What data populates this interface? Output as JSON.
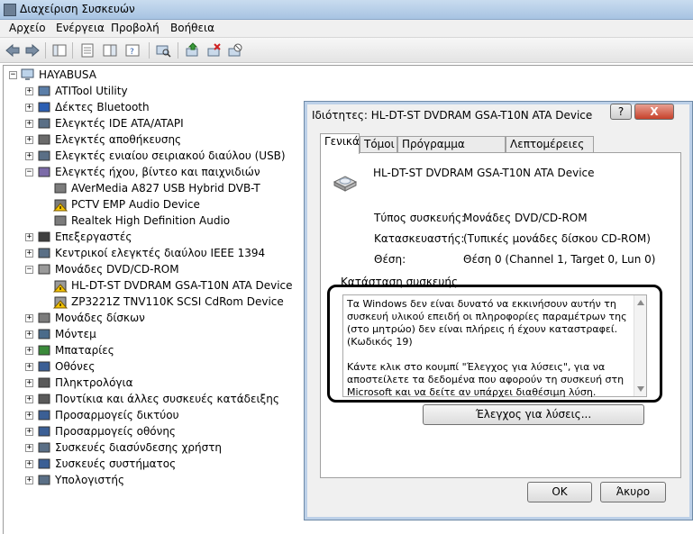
{
  "window": {
    "title": "Διαχείριση Συσκευών"
  },
  "menu": {
    "items": [
      "Αρχείο",
      "Ενέργεια",
      "Προβολή",
      "Βοήθεια"
    ]
  },
  "tree": {
    "root": "HAYABUSA",
    "items": [
      {
        "label": "ATITool Utility",
        "expand": "+"
      },
      {
        "label": "Δέκτες Bluetooth",
        "expand": "+"
      },
      {
        "label": "Ελεγκτές IDE ATA/ATAPI",
        "expand": "+"
      },
      {
        "label": "Ελεγκτές αποθήκευσης",
        "expand": "+"
      },
      {
        "label": "Ελεγκτές ενιαίου σειριακού διαύλου (USB)",
        "expand": "+"
      },
      {
        "label": "Ελεγκτές ήχου, βίντεο και παιχνιδιών",
        "expand": "−"
      },
      {
        "label": "AVerMedia A827 USB Hybrid DVB-T",
        "child": true,
        "warn": false
      },
      {
        "label": "PCTV EMP Audio Device",
        "child": true,
        "warn": true
      },
      {
        "label": "Realtek High Definition Audio",
        "child": true,
        "warn": false
      },
      {
        "label": "Επεξεργαστές",
        "expand": "+"
      },
      {
        "label": "Κεντρικοί ελεγκτές διαύλου IEEE 1394",
        "expand": "+"
      },
      {
        "label": "Μονάδες DVD/CD-ROM",
        "expand": "−"
      },
      {
        "label": "HL-DT-ST DVDRAM GSA-T10N ATA Device",
        "child": true,
        "warn": true
      },
      {
        "label": "ZP3221Z TNV110K SCSI CdRom Device",
        "child": true,
        "warn": true
      },
      {
        "label": "Μονάδες δίσκων",
        "expand": "+"
      },
      {
        "label": "Μόντεμ",
        "expand": "+"
      },
      {
        "label": "Μπαταρίες",
        "expand": "+"
      },
      {
        "label": "Οθόνες",
        "expand": "+"
      },
      {
        "label": "Πληκτρολόγια",
        "expand": "+"
      },
      {
        "label": "Ποντίκια και άλλες συσκευές κατάδειξης",
        "expand": "+"
      },
      {
        "label": "Προσαρμογείς δικτύου",
        "expand": "+"
      },
      {
        "label": "Προσαρμογείς οθόνης",
        "expand": "+"
      },
      {
        "label": "Συσκευές διασύνδεσης χρήστη",
        "expand": "+"
      },
      {
        "label": "Συσκευές συστήματος",
        "expand": "+"
      },
      {
        "label": "Υπολογιστής",
        "expand": "+"
      }
    ]
  },
  "dialog": {
    "title": "Ιδιότητες: HL-DT-ST DVDRAM GSA-T10N ATA Device",
    "help": "?",
    "close": "X",
    "tabs": [
      "Γενικά",
      "Τόμοι",
      "Πρόγραμμα οδήγησης",
      "Λεπτομέρειες"
    ],
    "device_name": "HL-DT-ST DVDRAM GSA-T10N ATA Device",
    "fields": [
      {
        "label": "Τύπος συσκευής:",
        "value": "Μονάδες DVD/CD-ROM"
      },
      {
        "label": "Κατασκευαστής:",
        "value": "(Τυπικές μονάδες δίσκου CD-ROM)"
      },
      {
        "label": "Θέση:",
        "value": "Θέση 0 (Channel 1, Target 0, Lun 0)"
      }
    ],
    "status_label": "Κατάσταση συσκευής",
    "status_p1": "Τα Windows δεν είναι δυνατό να εκκινήσουν αυτήν τη συσκευή υλικού επειδή οι πληροφορίες παραμέτρων της (στο μητρώο) δεν είναι πλήρεις ή έχουν καταστραφεί. (Κωδικός 19)",
    "status_p2": "Κάντε κλικ στο κουμπί \"Έλεγχος για λύσεις\", για να αποστείλετε τα δεδομένα που αφορούν τη συσκευή στη Microsoft και να δείτε αν υπάρχει διαθέσιμη λύση.",
    "check_button": "Έλεγχος για λύσεις...",
    "ok_button": "OK",
    "cancel_button": "Άκυρο"
  }
}
